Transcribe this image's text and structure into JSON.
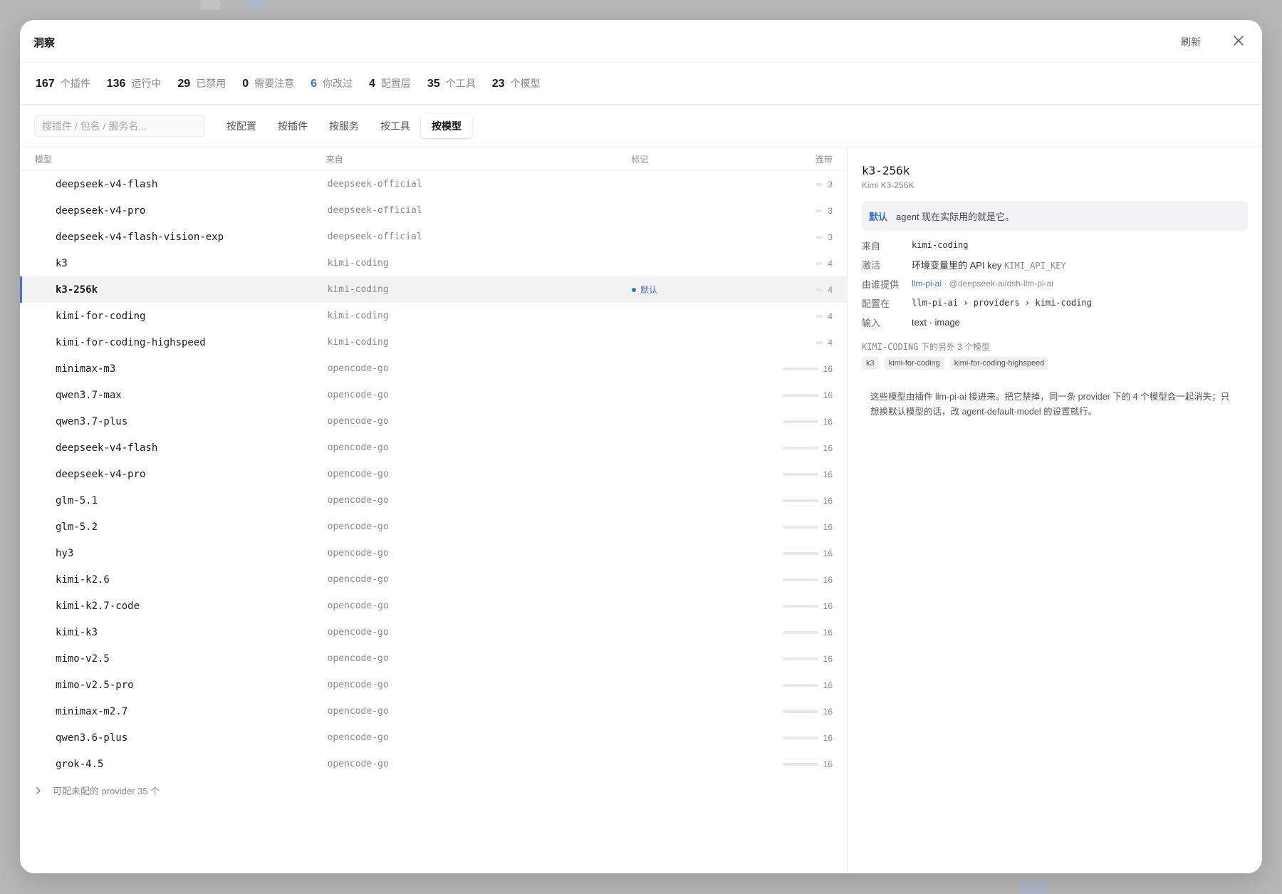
{
  "window": {
    "title": "洞察",
    "refresh_label": "刷新"
  },
  "stats": [
    {
      "num": "167",
      "label": "个插件",
      "highlight": false
    },
    {
      "num": "136",
      "label": "运行中",
      "highlight": false
    },
    {
      "num": "29",
      "label": "已禁用",
      "highlight": false
    },
    {
      "num": "0",
      "label": "需要注意",
      "highlight": false
    },
    {
      "num": "6",
      "label": "你改过",
      "highlight": true
    },
    {
      "num": "4",
      "label": "配置层",
      "highlight": false
    },
    {
      "num": "35",
      "label": "个工具",
      "highlight": false
    },
    {
      "num": "23",
      "label": "个模型",
      "highlight": false
    }
  ],
  "search": {
    "placeholder": "搜插件 / 包名 / 服务名...",
    "value": ""
  },
  "tabs": [
    {
      "label": "按配置",
      "active": false
    },
    {
      "label": "按插件",
      "active": false
    },
    {
      "label": "按服务",
      "active": false
    },
    {
      "label": "按工具",
      "active": false
    },
    {
      "label": "按模型",
      "active": true
    }
  ],
  "table": {
    "columns": {
      "model": "模型",
      "source": "来自",
      "tag": "标记",
      "linked": "连带"
    },
    "rows": [
      {
        "model": "deepseek-v4-flash",
        "source": "deepseek-official",
        "tag": "",
        "linked": "3",
        "selected": false
      },
      {
        "model": "deepseek-v4-pro",
        "source": "deepseek-official",
        "tag": "",
        "linked": "3",
        "selected": false
      },
      {
        "model": "deepseek-v4-flash-vision-exp",
        "source": "deepseek-official",
        "tag": "",
        "linked": "3",
        "selected": false
      },
      {
        "model": "k3",
        "source": "kimi-coding",
        "tag": "",
        "linked": "4",
        "selected": false
      },
      {
        "model": "k3-256k",
        "source": "kimi-coding",
        "tag": "默认",
        "linked": "4",
        "selected": true
      },
      {
        "model": "kimi-for-coding",
        "source": "kimi-coding",
        "tag": "",
        "linked": "4",
        "selected": false
      },
      {
        "model": "kimi-for-coding-highspeed",
        "source": "kimi-coding",
        "tag": "",
        "linked": "4",
        "selected": false
      },
      {
        "model": "minimax-m3",
        "source": "opencode-go",
        "tag": "",
        "linked": "16",
        "selected": false
      },
      {
        "model": "qwen3.7-max",
        "source": "opencode-go",
        "tag": "",
        "linked": "16",
        "selected": false
      },
      {
        "model": "qwen3.7-plus",
        "source": "opencode-go",
        "tag": "",
        "linked": "16",
        "selected": false
      },
      {
        "model": "deepseek-v4-flash",
        "source": "opencode-go",
        "tag": "",
        "linked": "16",
        "selected": false
      },
      {
        "model": "deepseek-v4-pro",
        "source": "opencode-go",
        "tag": "",
        "linked": "16",
        "selected": false
      },
      {
        "model": "glm-5.1",
        "source": "opencode-go",
        "tag": "",
        "linked": "16",
        "selected": false
      },
      {
        "model": "glm-5.2",
        "source": "opencode-go",
        "tag": "",
        "linked": "16",
        "selected": false
      },
      {
        "model": "hy3",
        "source": "opencode-go",
        "tag": "",
        "linked": "16",
        "selected": false
      },
      {
        "model": "kimi-k2.6",
        "source": "opencode-go",
        "tag": "",
        "linked": "16",
        "selected": false
      },
      {
        "model": "kimi-k2.7-code",
        "source": "opencode-go",
        "tag": "",
        "linked": "16",
        "selected": false
      },
      {
        "model": "kimi-k3",
        "source": "opencode-go",
        "tag": "",
        "linked": "16",
        "selected": false
      },
      {
        "model": "mimo-v2.5",
        "source": "opencode-go",
        "tag": "",
        "linked": "16",
        "selected": false
      },
      {
        "model": "mimo-v2.5-pro",
        "source": "opencode-go",
        "tag": "",
        "linked": "16",
        "selected": false
      },
      {
        "model": "minimax-m2.7",
        "source": "opencode-go",
        "tag": "",
        "linked": "16",
        "selected": false
      },
      {
        "model": "qwen3.6-plus",
        "source": "opencode-go",
        "tag": "",
        "linked": "16",
        "selected": false
      },
      {
        "model": "grok-4.5",
        "source": "opencode-go",
        "tag": "",
        "linked": "16",
        "selected": false
      }
    ],
    "expander_label": "可配未配的 provider 35 个"
  },
  "detail": {
    "title": "k3-256k",
    "subtitle": "Kimi K3-256K",
    "notice_badge": "默认",
    "notice_text": "agent 现在实际用的就是它。",
    "fields": {
      "source_key": "来自",
      "source_val": "kimi-coding",
      "activate_key": "激活",
      "activate_val": "环境变量里的 API key",
      "activate_env": "KIMI_API_KEY",
      "provider_key": "由谁提供",
      "provider_link": "llm-pi-ai",
      "provider_pkg": "· @deepseek-ai/dsh-llm-pi-ai",
      "config_key": "配置在",
      "config_val": "llm-pi-ai › providers › kimi-coding",
      "input_key": "输入",
      "input_val": "text · image"
    },
    "siblings_header_mono": "KIMI-CODING",
    "siblings_header_text": "下的另外 3 个模型",
    "siblings": [
      "k3",
      "kimi-for-coding",
      "kimi-for-coding-highspeed"
    ],
    "note": "这些模型由插件 llm-pi-ai 接进来。把它禁掉，同一条 provider 下的 4 个模型会一起消失；只想换默认模型的话，改 agent-default-model 的设置就行。"
  }
}
